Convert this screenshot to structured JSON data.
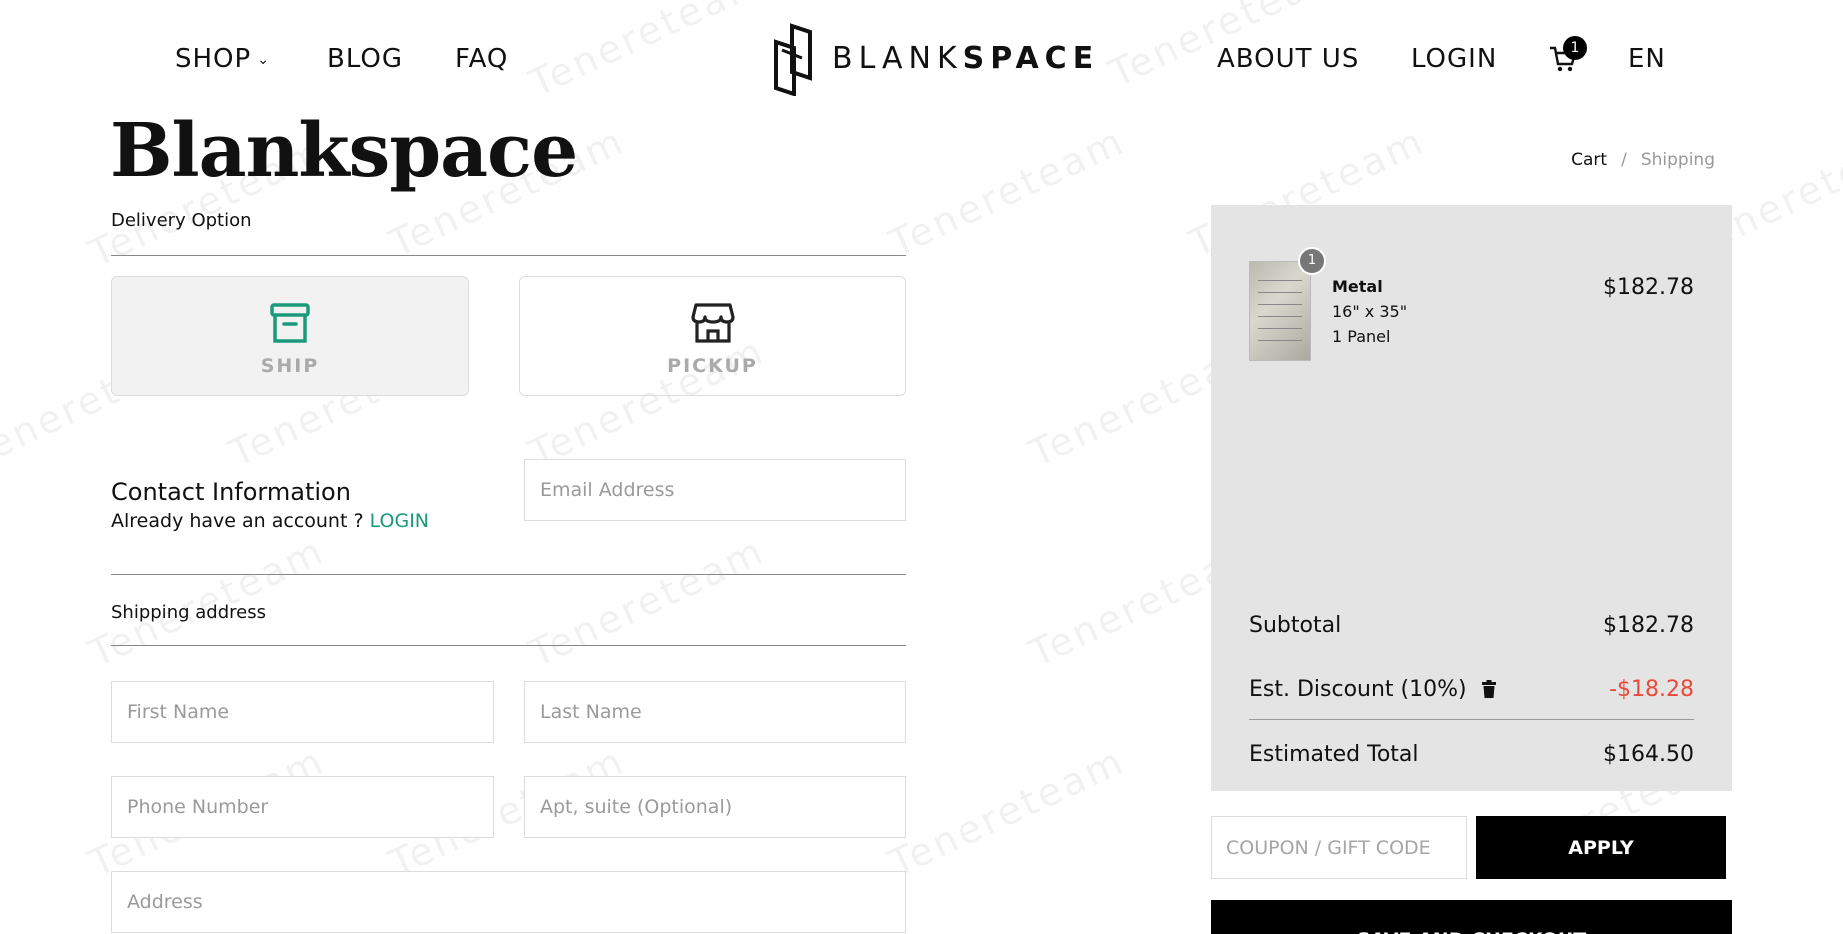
{
  "nav": {
    "shop": "SHOP",
    "blog": "BLOG",
    "faq": "FAQ",
    "about": "ABOUT US",
    "login": "LOGIN",
    "cart_count": "1",
    "language": "EN"
  },
  "logo": {
    "light": "BLANK",
    "bold": "SPACE"
  },
  "page": {
    "title": "Blankspace"
  },
  "breadcrumb": {
    "cart": "Cart",
    "separator": "/",
    "current": "Shipping"
  },
  "delivery": {
    "label": "Delivery Option",
    "options": [
      {
        "label": "SHIP",
        "icon": "box-icon",
        "selected": true
      },
      {
        "label": "PICKUP",
        "icon": "store-icon",
        "selected": false
      }
    ]
  },
  "contact": {
    "title": "Contact Information",
    "prompt": "Already have an account ?",
    "login_link": "LOGIN",
    "email_placeholder": "Email Address"
  },
  "shipping": {
    "label": "Shipping address",
    "first_name_placeholder": "First Name",
    "last_name_placeholder": "Last Name",
    "phone_placeholder": "Phone Number",
    "apt_placeholder": "Apt, suite (Optional)",
    "address_placeholder": "Address"
  },
  "summary": {
    "item": {
      "quantity": "1",
      "name": "Metal",
      "size": "16\" x 35\"",
      "panels": "1 Panel",
      "price": "$182.78"
    },
    "subtotal_label": "Subtotal",
    "subtotal": "$182.78",
    "discount_label": "Est. Discount (10%)",
    "discount": "-$18.28",
    "total_label": "Estimated Total",
    "total": "$164.50",
    "coupon_placeholder": "COUPON / GIFT CODE",
    "apply_label": "APPLY",
    "checkout_label": "SAVE AND CHECKOUT"
  },
  "colors": {
    "accent": "#1a9a7a",
    "discount": "#e8493a",
    "panel": "#e4e4e4",
    "button": "#000000"
  }
}
